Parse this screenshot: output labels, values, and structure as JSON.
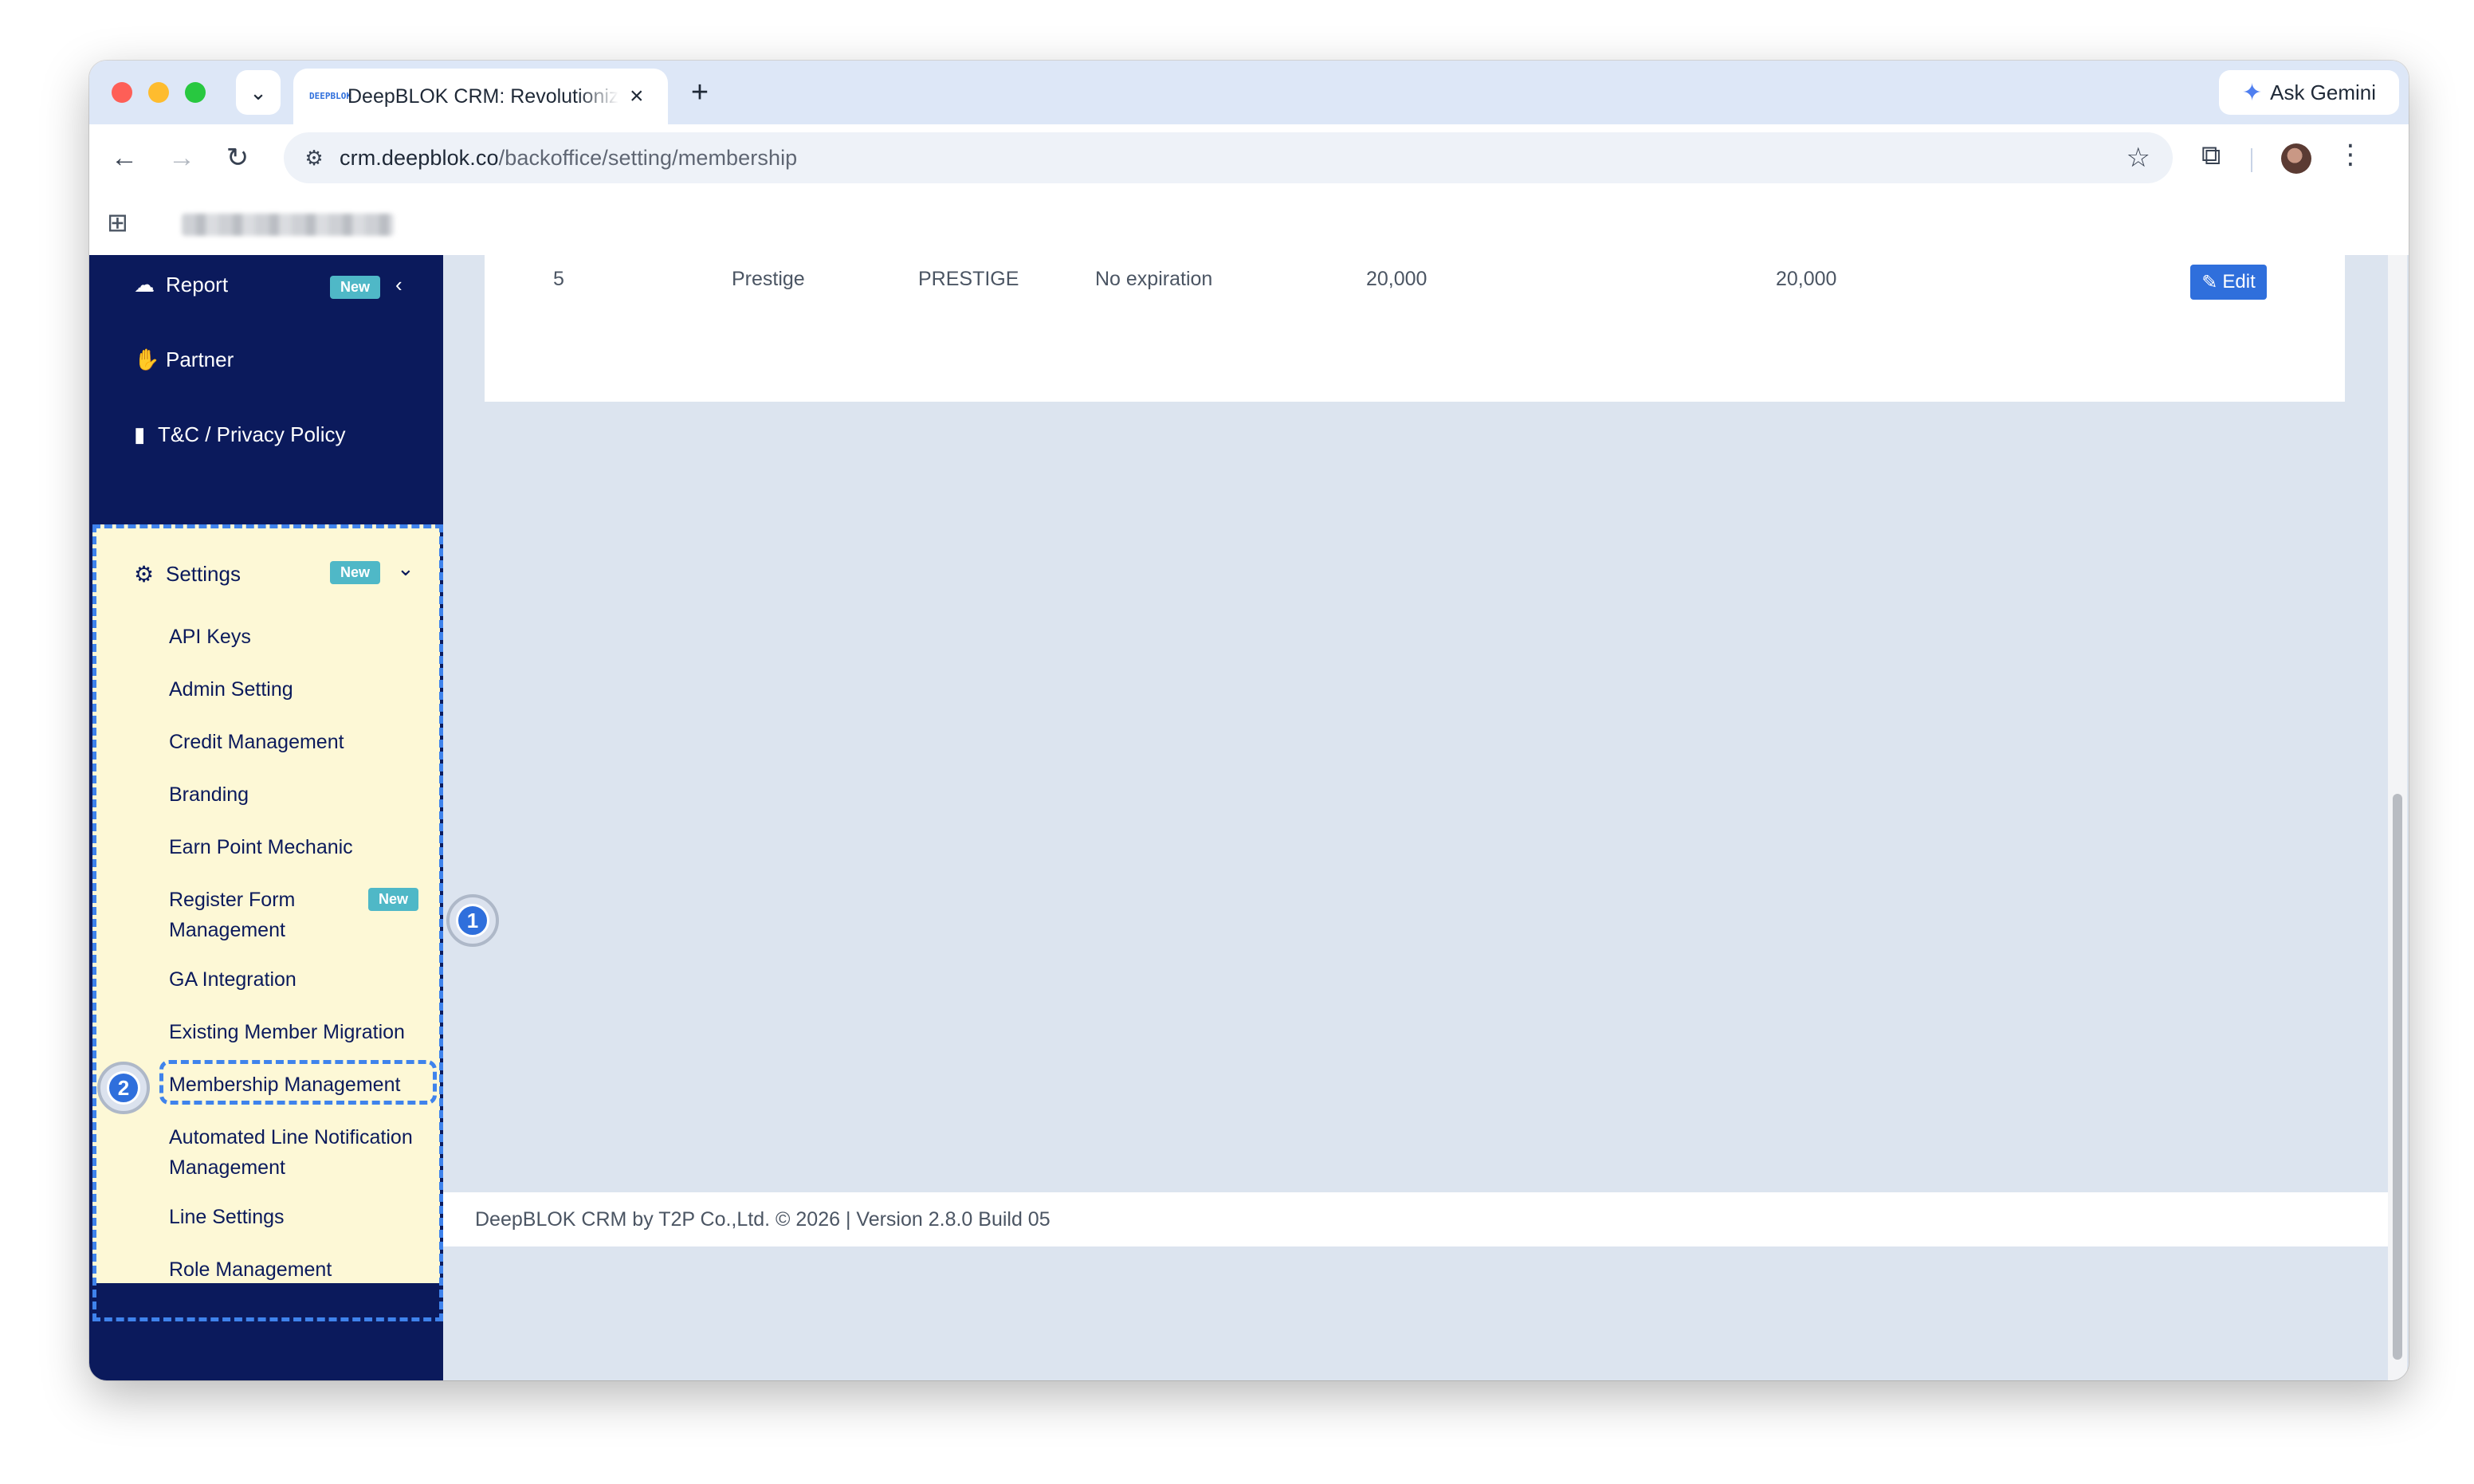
{
  "browser": {
    "tab_title": "DeepBLOK CRM: Revolutionize",
    "favicon_text": "DEEPBLOK",
    "new_tab": "+",
    "close_tab": "×",
    "gemini_label": "Ask Gemini",
    "url_host": "crm.deepblok.co",
    "url_path": "/backoffice/setting/membership"
  },
  "icons": {
    "back": "arrow-left-icon",
    "forward": "arrow-right-icon",
    "reload": "reload-icon",
    "bookmark": "star-icon",
    "extensions": "puzzle-icon",
    "menu": "kebab-icon",
    "apps": "apps-grid-icon"
  },
  "sidebar": {
    "report": "Report",
    "partner": "Partner",
    "tnc": "T&C / Privacy Policy",
    "settings": "Settings",
    "new_badge": "New",
    "settings_items": [
      {
        "label": "API Keys"
      },
      {
        "label": "Admin Setting"
      },
      {
        "label": "Credit Management"
      },
      {
        "label": "Branding"
      },
      {
        "label": "Earn Point Mechanic"
      },
      {
        "label": "Register Form Management",
        "badge": "New"
      },
      {
        "label": "GA Integration"
      },
      {
        "label": "Existing Member Migration"
      },
      {
        "label": "Membership Management"
      },
      {
        "label": "Automated Line Notification Management"
      },
      {
        "label": "Line Settings"
      },
      {
        "label": "Role Management"
      }
    ]
  },
  "table": {
    "row": {
      "no": "5",
      "name": "Prestige",
      "code": "PRESTIGE",
      "expiration": "No expiration",
      "value1": "20,000",
      "value2": "20,000",
      "edit": "Edit"
    }
  },
  "annotations": {
    "step1": "1",
    "step2": "2"
  },
  "footer": {
    "text": "DeepBLOK CRM by T2P Co.,Ltd. © 2026 | Version 2.8.0 Build 05"
  },
  "colors": {
    "sidebar_bg": "#0b1a5c",
    "highlight_bg": "#fdf8d6",
    "accent": "#2f6fdc",
    "badge": "#4fb8c7"
  }
}
